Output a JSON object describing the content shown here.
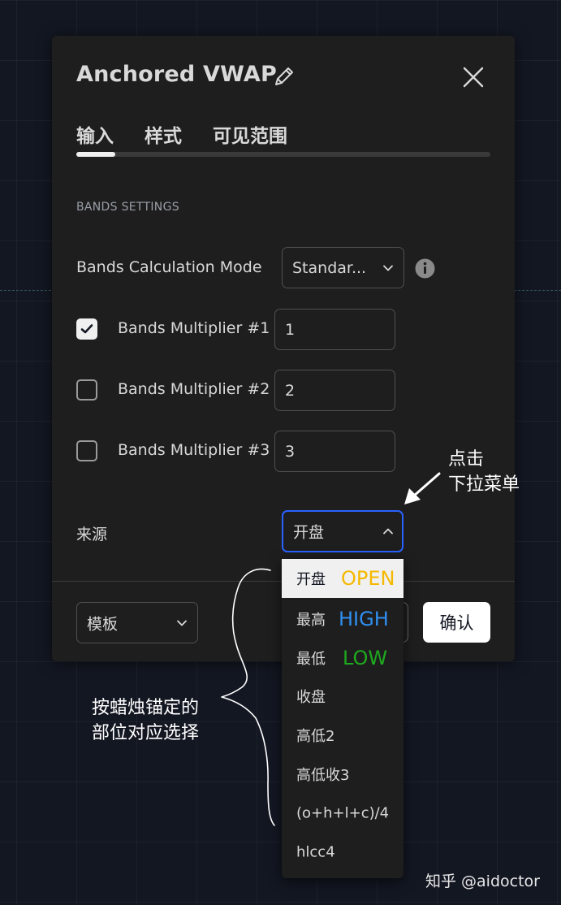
{
  "dialog": {
    "title": "Anchored VWAP",
    "tabs": [
      {
        "label": "输入"
      },
      {
        "label": "样式"
      },
      {
        "label": "可见范围"
      }
    ],
    "section_header": "BANDS SETTINGS",
    "calc_mode": {
      "label": "Bands Calculation Mode",
      "value": "Standar..."
    },
    "multipliers": [
      {
        "label": "Bands Multiplier #1",
        "value": "1",
        "checked": true
      },
      {
        "label": "Bands Multiplier #2",
        "value": "2",
        "checked": false
      },
      {
        "label": "Bands Multiplier #3",
        "value": "3",
        "checked": false
      }
    ],
    "source": {
      "label": "来源",
      "value": "开盘"
    },
    "footer": {
      "template_label": "模板",
      "confirm_label": "确认"
    }
  },
  "dropdown": {
    "options": [
      {
        "label": "开盘",
        "annotation": "OPEN",
        "annotation_color": "#f5b800"
      },
      {
        "label": "最高",
        "annotation": "HIGH",
        "annotation_color": "#2f8ff0"
      },
      {
        "label": "最低",
        "annotation": "LOW",
        "annotation_color": "#1eaa1e"
      },
      {
        "label": "收盘"
      },
      {
        "label": "高低2"
      },
      {
        "label": "高低收3"
      },
      {
        "label": "(o+h+l+c)/4"
      },
      {
        "label": "hlcc4"
      }
    ]
  },
  "annotations": {
    "click_hint_line1": "点击",
    "click_hint_line2": "下拉菜单",
    "select_hint_line1": "按蜡烛锚定的",
    "select_hint_line2": "部位对应选择"
  },
  "watermark": "知乎 @aidoctor",
  "colors": {
    "background": "#131722",
    "panel": "#1e1e1e",
    "focus_border": "#2962ff"
  }
}
